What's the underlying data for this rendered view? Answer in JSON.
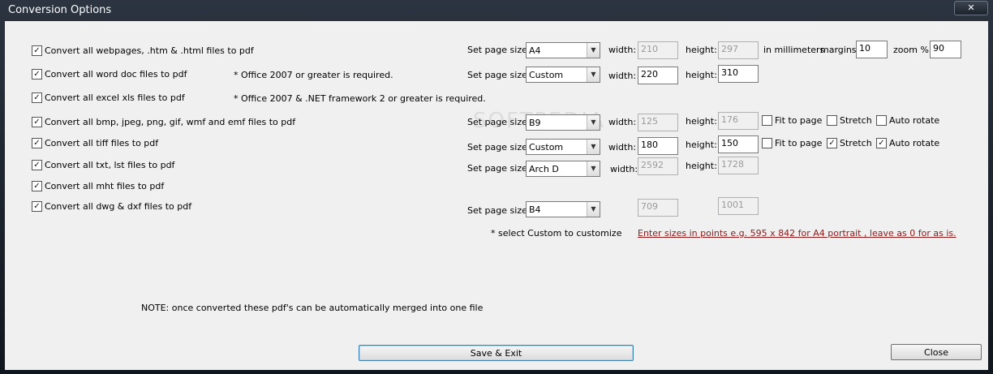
{
  "window": {
    "title": "Conversion Options",
    "close_glyph": "✕"
  },
  "options": [
    {
      "label": "Convert all webpages, .htm & .html files to pdf",
      "checked": true
    },
    {
      "label": "Convert all word doc files to pdf",
      "checked": true
    },
    {
      "label": "Convert all excel xls files to pdf",
      "checked": true
    },
    {
      "label": "Convert all bmp, jpeg, png, gif, wmf and emf files to pdf",
      "checked": true
    },
    {
      "label": "Convert all tiff files to pdf",
      "checked": true
    },
    {
      "label": "Convert all txt, lst files to pdf",
      "checked": true
    },
    {
      "label": "Convert all mht files to pdf",
      "checked": true
    },
    {
      "label": "Convert all dwg & dxf files to pdf",
      "checked": true
    }
  ],
  "notes": {
    "word": "* Office 2007 or greater is required.",
    "excel": "* Office 2007 & .NET framework 2 or greater is required.",
    "custom": "* select Custom to customize",
    "points": "Enter sizes in points e.g. 595 x 842 for A4 portrait , leave as 0 for as is.",
    "merge": "NOTE: once converted these pdf's can be automatically merged into one file"
  },
  "labels": {
    "set_page_size": "Set page size:",
    "width": "width:",
    "height": "height:",
    "in_millimeters": "in millimeters",
    "margins": "margins:",
    "zoom": "zoom %",
    "fit_to_page": "Fit to page",
    "stretch": "Stretch",
    "auto_rotate": "Auto rotate"
  },
  "web": {
    "page_size": "A4",
    "width": "210",
    "height": "297",
    "margins": "10",
    "zoom": "90"
  },
  "word": {
    "page_size": "Custom",
    "width": "220",
    "height": "310"
  },
  "image": {
    "page_size": "B9",
    "width": "125",
    "height": "176",
    "fit_to_page": false,
    "stretch": false,
    "auto_rotate": false
  },
  "tiff": {
    "page_size": "Custom",
    "width": "180",
    "height": "150",
    "fit_to_page": false,
    "stretch": true,
    "auto_rotate": true
  },
  "txt": {
    "page_size": "Arch D",
    "width": "2592",
    "height": "1728"
  },
  "dwg": {
    "page_size": "B4",
    "width": "709",
    "height": "1001"
  },
  "buttons": {
    "save_exit": "Save & Exit",
    "close": "Close"
  },
  "watermark": "SOFTPEDIA",
  "icons": {
    "checkbox_checked": "✓",
    "dropdown_arrow": "▼"
  }
}
